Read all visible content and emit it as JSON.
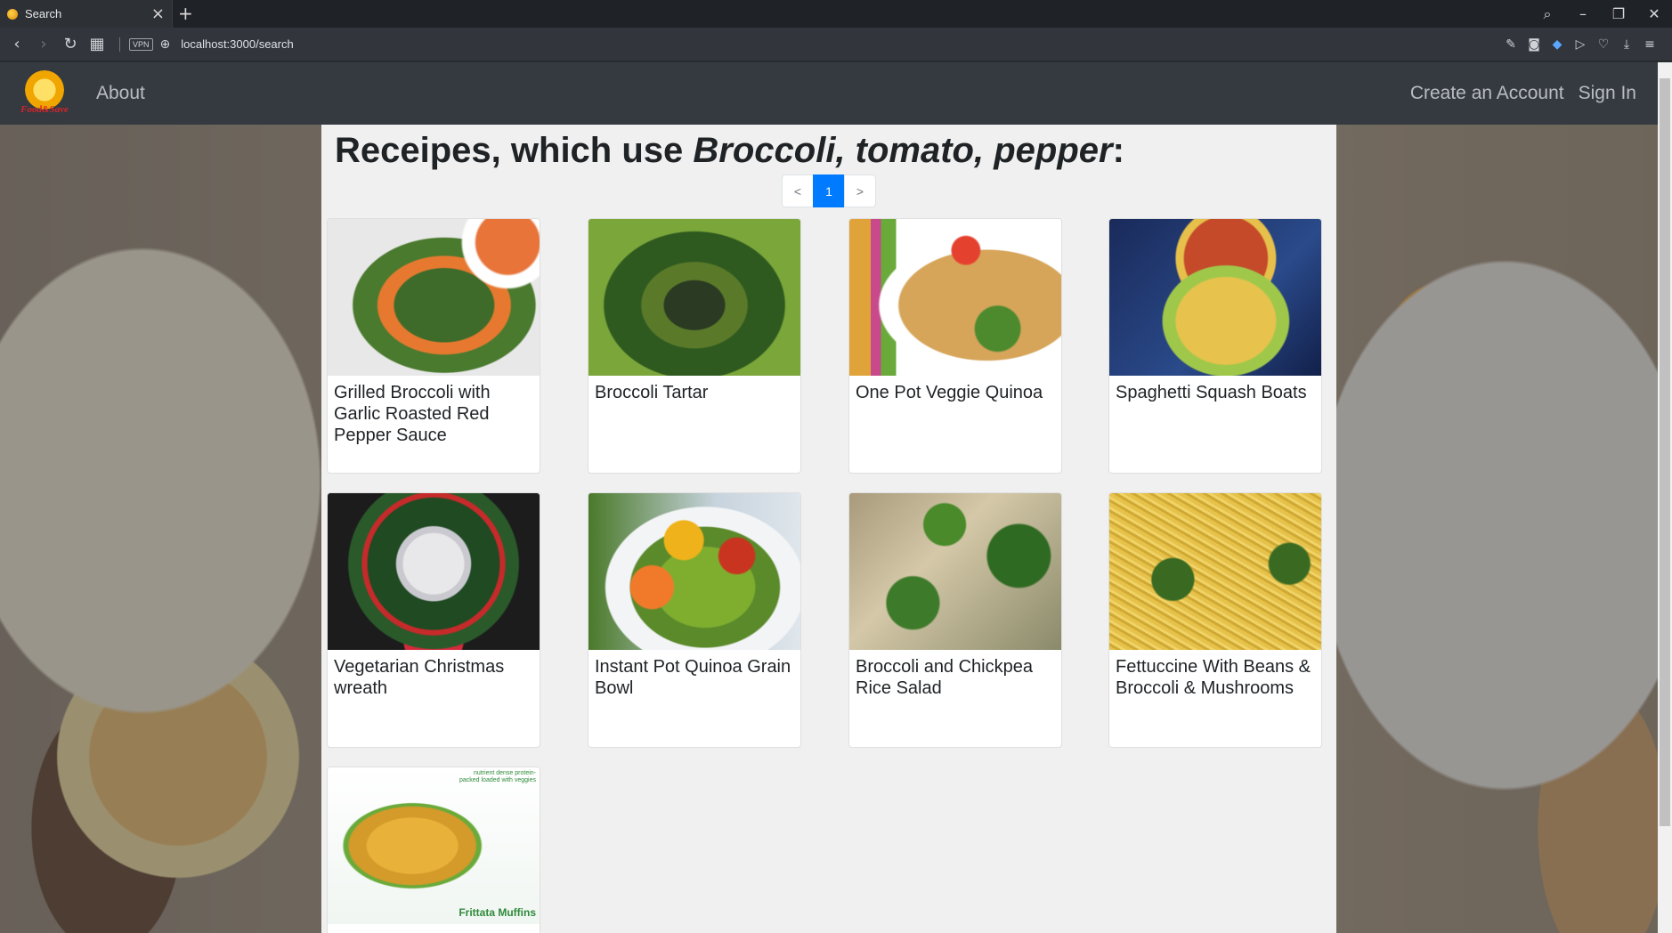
{
  "browser": {
    "tab_title": "Search",
    "url": "localhost:3000/search",
    "vpn_label": "VPN"
  },
  "navbar": {
    "brand": "Food&Save",
    "about": "About",
    "create_account": "Create an Account",
    "sign_in": "Sign In"
  },
  "search": {
    "heading_prefix": "Receipes, which use ",
    "ingredients": "Broccoli, tomato, pepper",
    "heading_suffix": ":"
  },
  "pagination": {
    "prev": "<",
    "current": "1",
    "next": ">"
  },
  "recipes": [
    {
      "title": "Grilled Broccoli with Garlic Roasted Red Pepper Sauce"
    },
    {
      "title": "Broccoli Tartar"
    },
    {
      "title": "One Pot Veggie Quinoa"
    },
    {
      "title": "Spaghetti Squash Boats"
    },
    {
      "title": "Vegetarian Christmas wreath"
    },
    {
      "title": "Instant Pot Quinoa Grain Bowl"
    },
    {
      "title": "Broccoli and Chickpea Rice Salad"
    },
    {
      "title": "Fettuccine With Beans & Broccoli & Mushrooms"
    },
    {
      "title": "",
      "image_caption": "Frittata Muffins",
      "image_note": "nutrient dense protein-packed loaded with veggies"
    }
  ]
}
